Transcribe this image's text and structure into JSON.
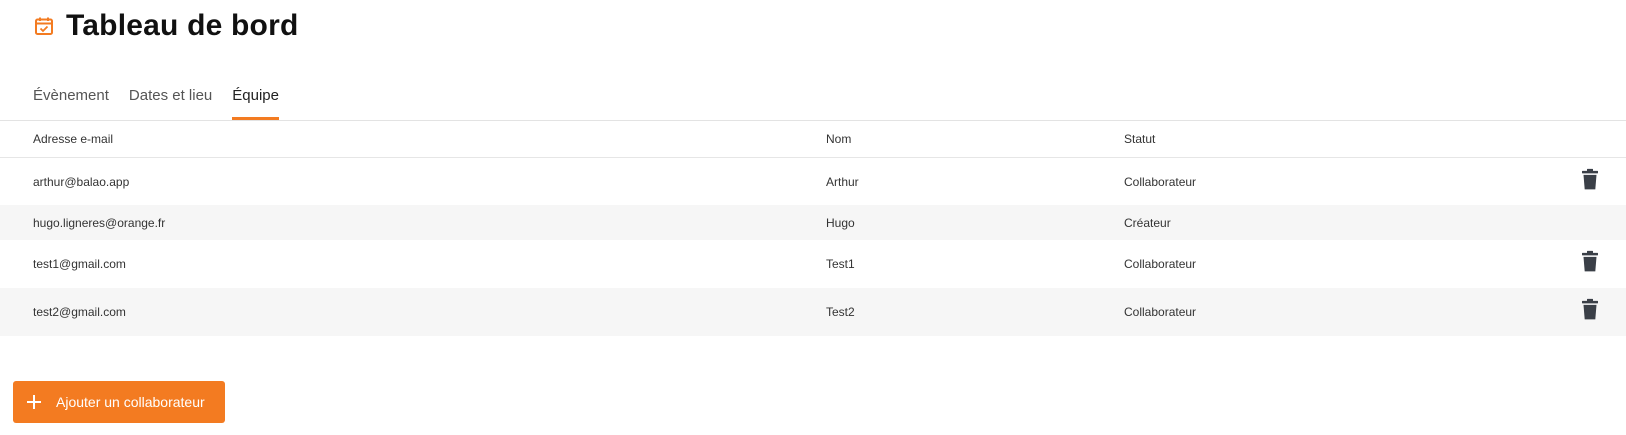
{
  "header": {
    "title": "Tableau de bord",
    "icon": "calendar-check-icon",
    "accent_color": "#f37b21"
  },
  "tabs": [
    {
      "label": "Évènement",
      "active": false
    },
    {
      "label": "Dates et lieu",
      "active": false
    },
    {
      "label": "Équipe",
      "active": true
    }
  ],
  "table": {
    "columns": [
      "Adresse e-mail",
      "Nom",
      "Statut"
    ],
    "rows": [
      {
        "email": "arthur@balao.app",
        "name": "Arthur",
        "status": "Collaborateur",
        "deletable": true
      },
      {
        "email": "hugo.ligneres@orange.fr",
        "name": "Hugo",
        "status": "Créateur",
        "deletable": false
      },
      {
        "email": "test1@gmail.com",
        "name": "Test1",
        "status": "Collaborateur",
        "deletable": true
      },
      {
        "email": "test2@gmail.com",
        "name": "Test2",
        "status": "Collaborateur",
        "deletable": true
      }
    ],
    "delete_icon": "trash-icon"
  },
  "add_button": {
    "label": "Ajouter un collaborateur",
    "icon": "plus-icon"
  }
}
